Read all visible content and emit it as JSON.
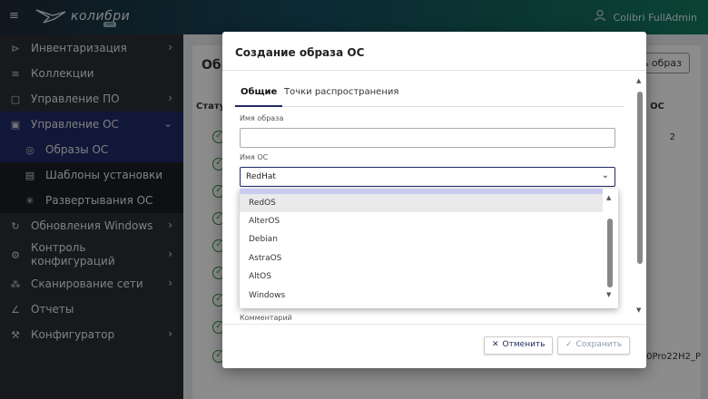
{
  "app": {
    "logo_text": "колибри",
    "logo_badge": "nm",
    "user_name": "Colibri FullAdmin"
  },
  "sidebar": {
    "items": [
      {
        "label": "Инвентаризация",
        "icon": "inventory-icon",
        "glyph": "⊳",
        "chevron": true
      },
      {
        "label": "Коллекции",
        "icon": "list-icon",
        "glyph": "≡",
        "chevron": false
      },
      {
        "label": "Управление ПО",
        "icon": "software-icon",
        "glyph": "▢",
        "chevron": true
      },
      {
        "label": "Управление ОС",
        "icon": "os-icon",
        "glyph": "▣",
        "chevron": true,
        "expanded": true
      },
      {
        "label": "Образы ОС",
        "icon": "disc-icon",
        "glyph": "◎",
        "sub": true,
        "selected": true
      },
      {
        "label": "Шаблоны установки",
        "icon": "template-icon",
        "glyph": "▤",
        "sub": true
      },
      {
        "label": "Развертывания ОС",
        "icon": "deploy-icon",
        "glyph": "✳",
        "sub": true
      },
      {
        "label": "Обновления Windows",
        "icon": "refresh-icon",
        "glyph": "↻",
        "chevron": true
      },
      {
        "label": "Контроль конфигураций",
        "icon": "config-icon",
        "glyph": "⚙",
        "chevron": true
      },
      {
        "label": "Сканирование сети",
        "icon": "network-icon",
        "glyph": "⁂",
        "chevron": true
      },
      {
        "label": "Отчеты",
        "icon": "chart-icon",
        "glyph": "∠",
        "chevron": false
      },
      {
        "label": "Конфигуратор",
        "icon": "wrench-icon",
        "glyph": "⚒",
        "chevron": true
      }
    ]
  },
  "background": {
    "title_fragment": "Обр",
    "create_button_fragment": "ть образ",
    "col_status_fragment": "Статус",
    "col_os_fragment": "я ОС",
    "first_row_fragment": "2",
    "last_row_fragment": "n10Pro22H2_P"
  },
  "dialog": {
    "title": "Создание образа ОС",
    "tabs": [
      "Общие",
      "Точки распространения"
    ],
    "image_name_label": "Имя образа",
    "image_name_value": "",
    "os_name_label": "Имя ОС",
    "os_name_value": "RedHat",
    "comment_label": "Комментарий",
    "cancel_label": "Отменить",
    "save_label": "Сохранить"
  },
  "dropdown": {
    "options": [
      "RedOS",
      "AlterOS",
      "Debian",
      "AstraOS",
      "AltOS",
      "Windows"
    ],
    "hovered": "RedOS"
  },
  "colors": {
    "accent": "#1f2a66",
    "success": "#2e8b3a",
    "topbar_start": "#1e2a3a",
    "topbar_end": "#137a5e"
  }
}
